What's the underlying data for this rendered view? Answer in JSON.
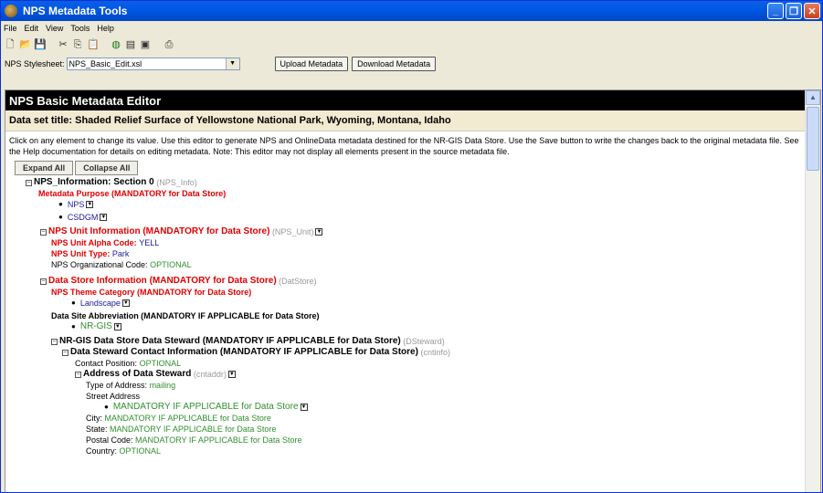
{
  "window": {
    "title": "NPS Metadata Tools"
  },
  "menu": [
    "File",
    "Edit",
    "View",
    "Tools",
    "Help"
  ],
  "toolbar": {
    "icons": [
      "new-icon",
      "open-icon",
      "save-icon",
      "cut-icon",
      "copy-icon",
      "paste-icon",
      "globe-icon",
      "tree-icon",
      "export-icon",
      "print-icon"
    ]
  },
  "stylesheet": {
    "label": "NPS Stylesheet:",
    "value": "NPS_Basic_Edit.xsl",
    "upload": "Upload Metadata",
    "download": "Download Metadata"
  },
  "editor": {
    "heading": "NPS Basic Metadata Editor",
    "dataset_title": "Data set title: Shaded Relief Surface of Yellowstone National Park, Wyoming, Montana, Idaho",
    "intro": "Click on any element to change its value. Use this editor to generate NPS and OnlineData metadata destined for the NR-GIS Data Store. Use the Save button to write the changes back to the original metadata file. See the Help documentation for details on editing metadata. Note: This editor may not display all elements present in the source metadata file.",
    "expand_all": "Expand All",
    "collapse_all": "Collapse All"
  },
  "tree": {
    "nps_info": {
      "label": "NPS_Information: Section 0",
      "tag": "(NPS_Info)"
    },
    "metadata_purpose": "Metadata Purpose (MANDATORY for Data Store)",
    "purpose_items": [
      "NPS",
      "CSDGM"
    ],
    "unit": {
      "label": "NPS Unit Information (MANDATORY for Data Store)",
      "tag": "(NPS_Unit)"
    },
    "unit_alpha": {
      "label": "NPS Unit Alpha Code:",
      "value": "YELL"
    },
    "unit_type": {
      "label": "NPS Unit Type:",
      "value": "Park"
    },
    "org_code": {
      "label": "NPS Organizational Code:",
      "value": "OPTIONAL"
    },
    "datastore": {
      "label": "Data Store Information (MANDATORY for Data Store)",
      "tag": "(DatStore)"
    },
    "theme": "NPS Theme Category (MANDATORY for Data Store)",
    "theme_item": "Landscape",
    "site_abbrev": "Data Site Abbreviation (MANDATORY IF APPLICABLE for Data Store)",
    "site_item": "NR-GIS",
    "steward": {
      "label": "NR-GIS Data Store Data Steward (MANDATORY IF APPLICABLE for Data Store)",
      "tag": "(DSteward)"
    },
    "contact": {
      "label": "Data Steward Contact Information (MANDATORY IF APPLICABLE for Data Store)",
      "tag": "(cntinfo)"
    },
    "contact_position": {
      "label": "Contact Position:",
      "value": "OPTIONAL"
    },
    "address": {
      "label": "Address of Data Steward",
      "tag": "(cntaddr)"
    },
    "address_type": {
      "label": "Type of Address:",
      "value": "mailing"
    },
    "street_label": "Street Address",
    "street_item": "MANDATORY IF APPLICABLE for Data Store",
    "city": {
      "label": "City:",
      "value": "MANDATORY IF APPLICABLE for Data Store"
    },
    "state": {
      "label": "State:",
      "value": "MANDATORY IF APPLICABLE for Data Store"
    },
    "postal": {
      "label": "Postal Code:",
      "value": "MANDATORY IF APPLICABLE for Data Store"
    },
    "country": {
      "label": "Country:",
      "value": "OPTIONAL"
    }
  },
  "colors": {
    "titlebar": "#0058e6",
    "mandatory": "#e00000",
    "value_blue": "#1a1a9c",
    "value_green": "#2f8f2f"
  }
}
